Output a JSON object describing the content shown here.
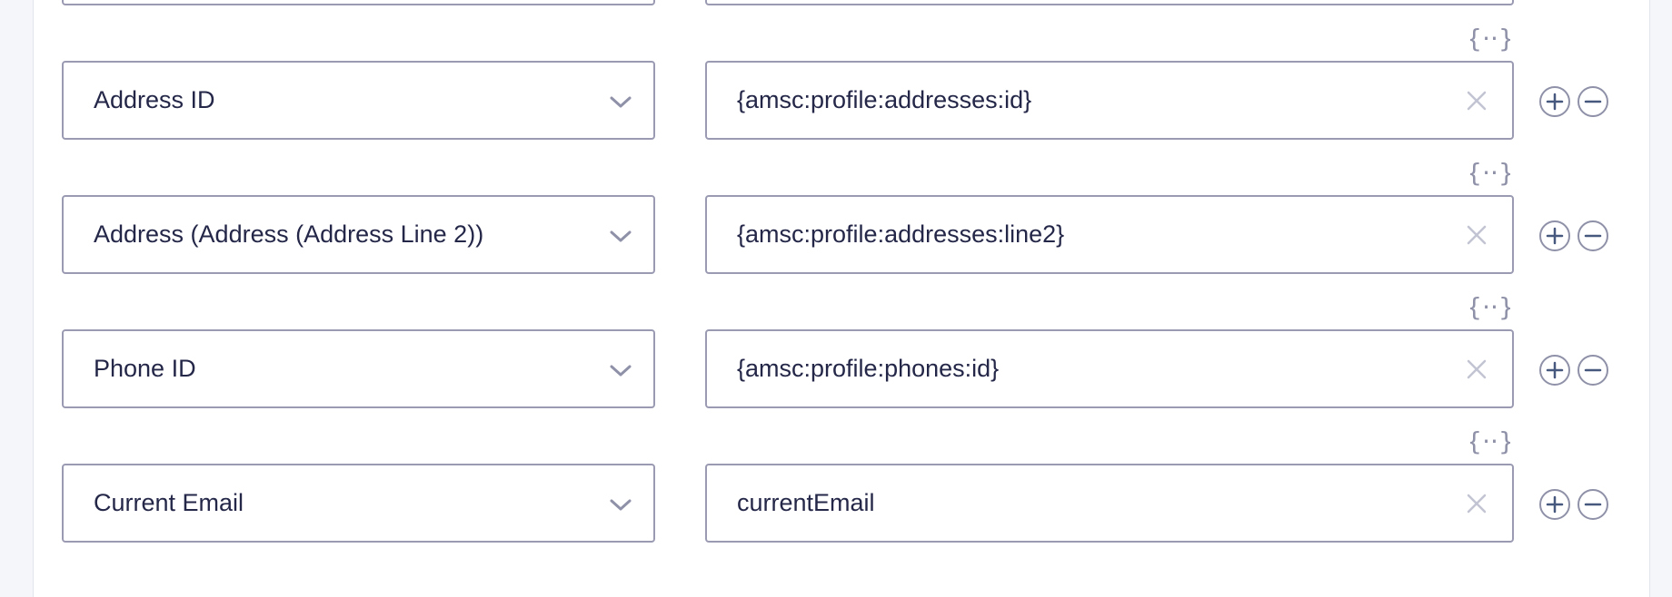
{
  "rows": [
    {
      "field_label": "Address ID",
      "value": "{amsc:profile:addresses:id}"
    },
    {
      "field_label": "Address (Address (Address Line 2))",
      "value": "{amsc:profile:addresses:line2}"
    },
    {
      "field_label": "Phone ID",
      "value": "{amsc:profile:phones:id}"
    },
    {
      "field_label": "Current Email",
      "value": "currentEmail"
    }
  ],
  "icons": {
    "merge_tag": "merge-tag-icon",
    "dropdown": "chevron-down-icon",
    "clear": "close-icon",
    "add": "plus-circle-icon",
    "remove": "minus-circle-icon"
  },
  "colors": {
    "border": "#9a9bb3",
    "text": "#242748",
    "icon": "#8f91a8",
    "button": "#5b6a8c",
    "background": "#f5f6fa"
  }
}
